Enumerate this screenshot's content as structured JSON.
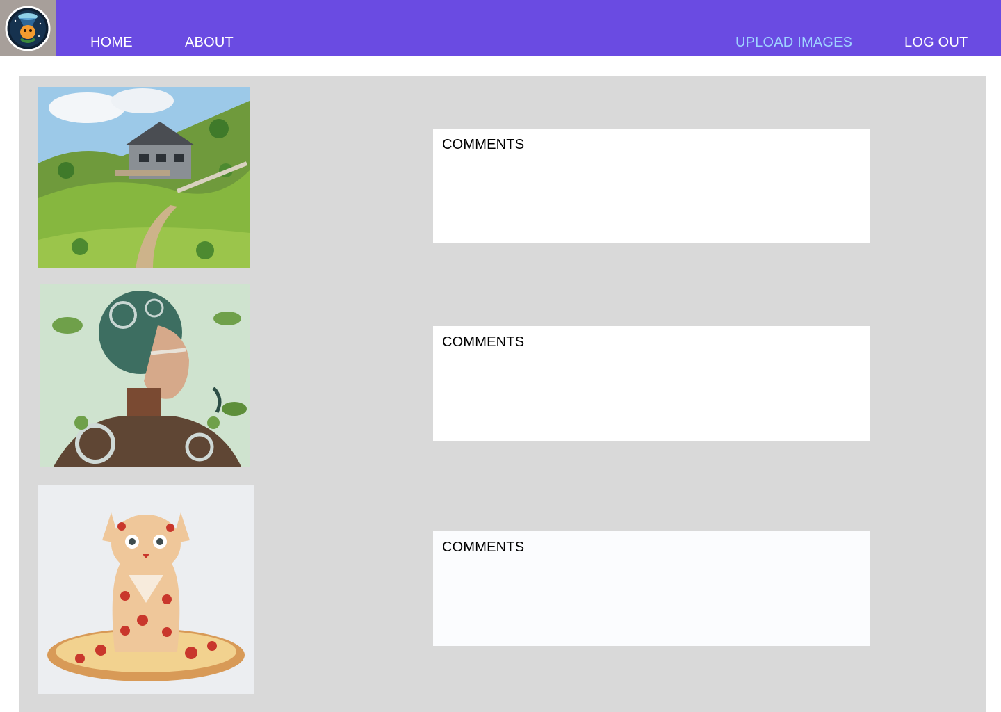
{
  "nav": {
    "logo_icon": "mascot-logo-icon",
    "links": [
      {
        "label": "HOME",
        "active": false
      },
      {
        "label": "ABOUT",
        "active": false
      },
      {
        "label": "UPLOAD IMAGES",
        "active": true
      },
      {
        "label": "LOG OUT",
        "active": false
      }
    ]
  },
  "colors": {
    "navbar": "#6a4be2",
    "active_link": "#9fd2ff",
    "panel": "#d9d9d9"
  },
  "posts": [
    {
      "image": "house-on-hill-image",
      "comments_label": "COMMENTS"
    },
    {
      "image": "cyborg-woman-image",
      "comments_label": "COMMENTS"
    },
    {
      "image": "pizza-cat-image",
      "comments_label": "COMMENTS"
    }
  ]
}
